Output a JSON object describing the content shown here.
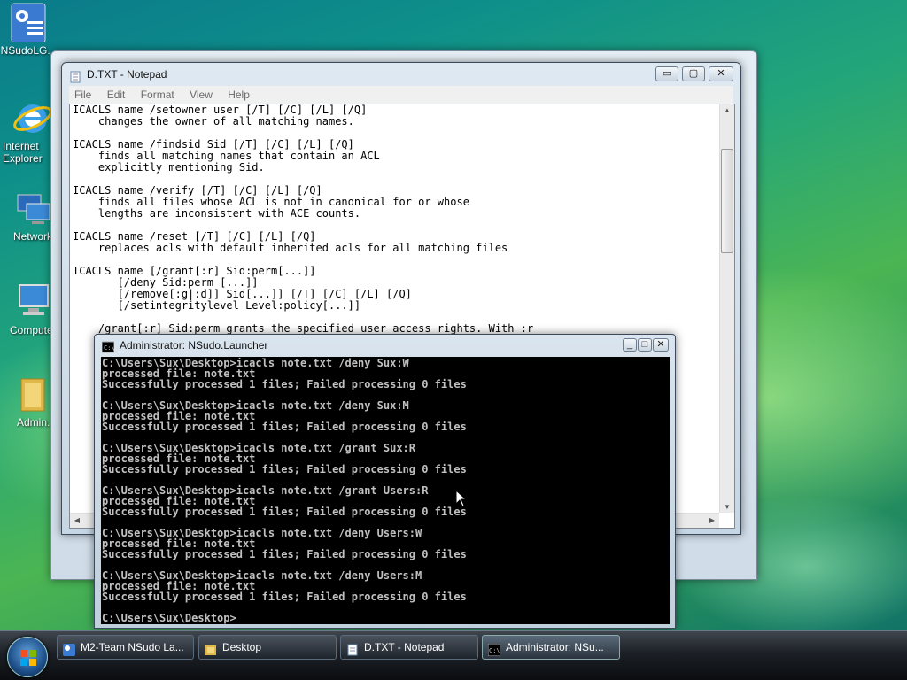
{
  "desktop": {
    "icons": [
      {
        "label": "NSudoLG...",
        "icon": "settings-shortcut-icon"
      },
      {
        "label": "Internet Explorer",
        "icon": "internet-explorer-icon"
      },
      {
        "label": "Network",
        "icon": "network-icon"
      },
      {
        "label": "Computer",
        "icon": "computer-icon"
      },
      {
        "label": "Admin...",
        "icon": "folder-icon"
      }
    ]
  },
  "notepad": {
    "title": "D.TXT - Notepad",
    "menu": [
      "File",
      "Edit",
      "Format",
      "View",
      "Help"
    ],
    "content": "ICACLS name /setowner user [/T] [/C] [/L] [/Q]\n    changes the owner of all matching names.\n\nICACLS name /findsid Sid [/T] [/C] [/L] [/Q]\n    finds all matching names that contain an ACL\n    explicitly mentioning Sid.\n\nICACLS name /verify [/T] [/C] [/L] [/Q]\n    finds all files whose ACL is not in canonical for or whose\n    lengths are inconsistent with ACE counts.\n\nICACLS name /reset [/T] [/C] [/L] [/Q]\n    replaces acls with default inherited acls for all matching files\n\nICACLS name [/grant[:r] Sid:perm[...]]\n       [/deny Sid:perm [...]]\n       [/remove[:g|:d]] Sid[...]] [/T] [/C] [/L] [/Q]\n       [/setintegritylevel Level:policy[...]]\n\n    /grant[:r] Sid:perm grants the specified user access rights. With :r"
  },
  "console": {
    "title": "Administrator: NSudo.Launcher",
    "output": "C:\\Users\\Sux\\Desktop>icacls note.txt /deny Sux:W\nprocessed file: note.txt\nSuccessfully processed 1 files; Failed processing 0 files\n\nC:\\Users\\Sux\\Desktop>icacls note.txt /deny Sux:M\nprocessed file: note.txt\nSuccessfully processed 1 files; Failed processing 0 files\n\nC:\\Users\\Sux\\Desktop>icacls note.txt /grant Sux:R\nprocessed file: note.txt\nSuccessfully processed 1 files; Failed processing 0 files\n\nC:\\Users\\Sux\\Desktop>icacls note.txt /grant Users:R\nprocessed file: note.txt\nSuccessfully processed 1 files; Failed processing 0 files\n\nC:\\Users\\Sux\\Desktop>icacls note.txt /deny Users:W\nprocessed file: note.txt\nSuccessfully processed 1 files; Failed processing 0 files\n\nC:\\Users\\Sux\\Desktop>icacls note.txt /deny Users:M\nprocessed file: note.txt\nSuccessfully processed 1 files; Failed processing 0 files\n\nC:\\Users\\Sux\\Desktop>"
  },
  "taskbar": {
    "items": [
      {
        "label": "M2-Team NSudo La...",
        "icon": "settings-shortcut-icon"
      },
      {
        "label": "Desktop",
        "icon": "folder-icon"
      },
      {
        "label": "D.TXT - Notepad",
        "icon": "notepad-icon"
      },
      {
        "label": "Administrator: NSu...",
        "icon": "console-icon"
      }
    ]
  },
  "colors": {
    "console_bg": "#000000",
    "console_fg": "#c0c0c0",
    "accent": "#1e4f8a"
  }
}
